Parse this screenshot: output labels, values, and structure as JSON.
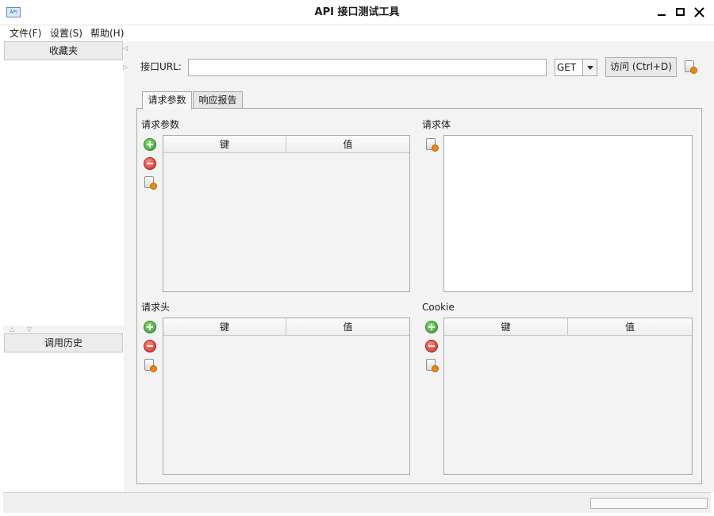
{
  "window": {
    "title": "API 接口测试工具",
    "icon": "app-icon",
    "icon_text": "API",
    "controls": [
      "minimize-icon",
      "maximize-icon",
      "close-icon"
    ]
  },
  "menu": [
    {
      "label": "文件(F)"
    },
    {
      "label": "设置(S)"
    },
    {
      "label": "帮助(H)"
    }
  ],
  "sidebar": {
    "favorites_label": "收藏夹",
    "history_label": "调用历史"
  },
  "request": {
    "url_label": "接口URL:",
    "url_value": "",
    "method": "GET",
    "visit_button": "访问 (Ctrl+D)"
  },
  "tabs": [
    {
      "label": "请求参数",
      "active": true
    },
    {
      "label": "响应报告",
      "active": false
    }
  ],
  "sections": {
    "params": {
      "title": "请求参数",
      "columns": [
        "键",
        "值"
      ],
      "rows": []
    },
    "body": {
      "title": "请求体",
      "value": ""
    },
    "headers": {
      "title": "请求头",
      "columns": [
        "键",
        "值"
      ],
      "rows": []
    },
    "cookie": {
      "title": "Cookie",
      "columns": [
        "键",
        "值"
      ],
      "rows": []
    }
  },
  "colors": {
    "add": "#2f9a27",
    "remove": "#c62b21",
    "clear": "#e98a16"
  }
}
